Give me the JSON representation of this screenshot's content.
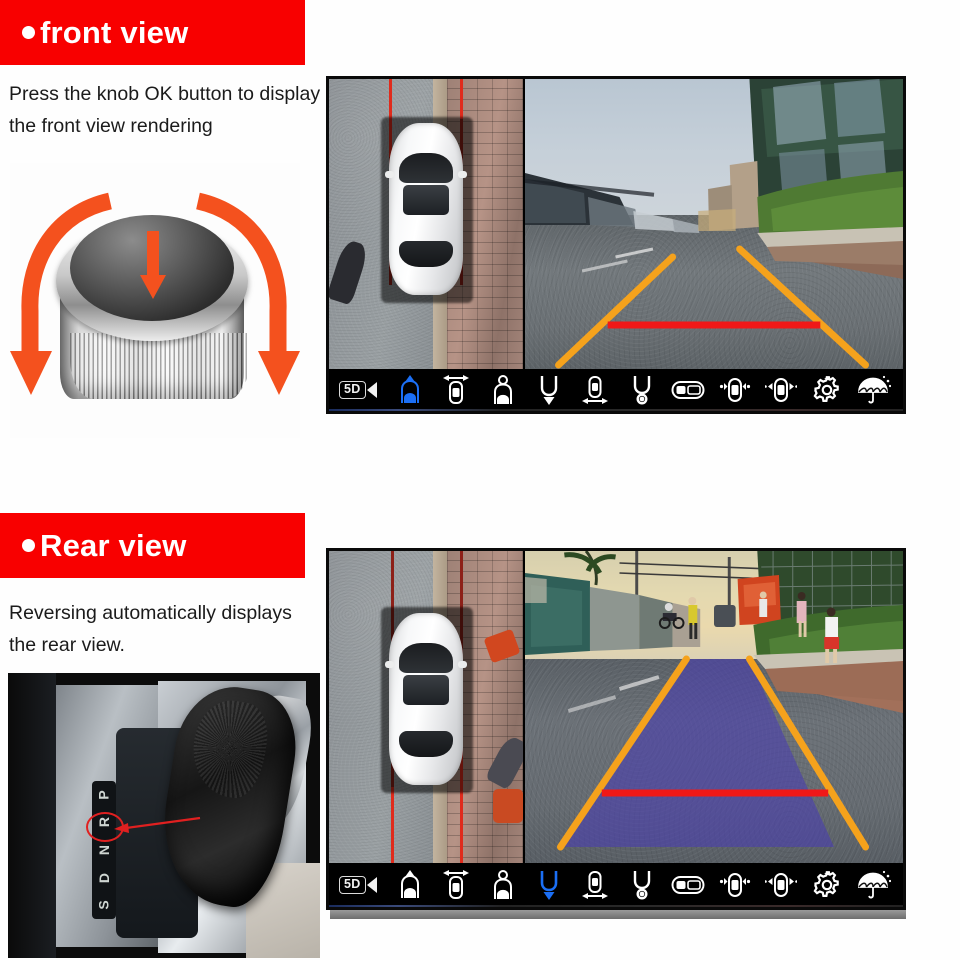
{
  "sections": [
    {
      "id": "front",
      "banner_label": "front view",
      "caption": "Press the knob OK button to display the front view rendering",
      "illustration": "rotary-knob-ok-button",
      "headunit": {
        "badge": "5D",
        "active_icon_index": 1,
        "bird_view": {
          "label": "bird-eye-view",
          "guide_line_color": "#e02b1c",
          "guide_position": "front"
        },
        "camera_view": {
          "label": "front-camera-view",
          "trajectory_color": "#f5a21c",
          "distance_bar_color": "#f01818",
          "overlay_fill": "none"
        },
        "toolbar_icons": [
          "front-view-icon",
          "top-view-width-icon",
          "panorama-view-icon",
          "rear-view-icon",
          "side-width-view-icon",
          "wheel-view-icon",
          "split-screen-icon",
          "left-right-view-icon",
          "front-rear-view-icon",
          "settings-gear-icon",
          "umbrella-rain-icon"
        ]
      }
    },
    {
      "id": "rear",
      "banner_label": "Rear view",
      "caption": "Reversing automatically displays the rear view.",
      "illustration": "gear-shifter-reverse",
      "shifter": {
        "positions": [
          "P",
          "R",
          "N",
          "D",
          "S"
        ],
        "highlighted": "R",
        "marker_color": "#e02020"
      },
      "headunit": {
        "badge": "5D",
        "active_icon_index": 4,
        "bird_view": {
          "label": "bird-eye-view",
          "guide_line_color": "#e02b1c",
          "guide_position": "rear"
        },
        "camera_view": {
          "label": "rear-camera-view",
          "trajectory_color": "#f5a21c",
          "distance_bar_color": "#f01818",
          "overlay_fill": "#4a3fae"
        },
        "toolbar_icons": [
          "front-view-icon",
          "top-view-width-icon",
          "panorama-view-icon",
          "rear-view-icon",
          "side-width-view-icon",
          "wheel-view-icon",
          "split-screen-icon",
          "left-right-view-icon",
          "front-rear-view-icon",
          "settings-gear-icon",
          "umbrella-rain-icon"
        ]
      }
    }
  ],
  "colors": {
    "banner_red": "#f80000",
    "accent_orange": "#f4511e",
    "active_blue": "#1b6ff5",
    "guide_red": "#e02b1c",
    "trajectory_orange": "#f5a21c",
    "overlay_violet": "#4a3fae"
  }
}
